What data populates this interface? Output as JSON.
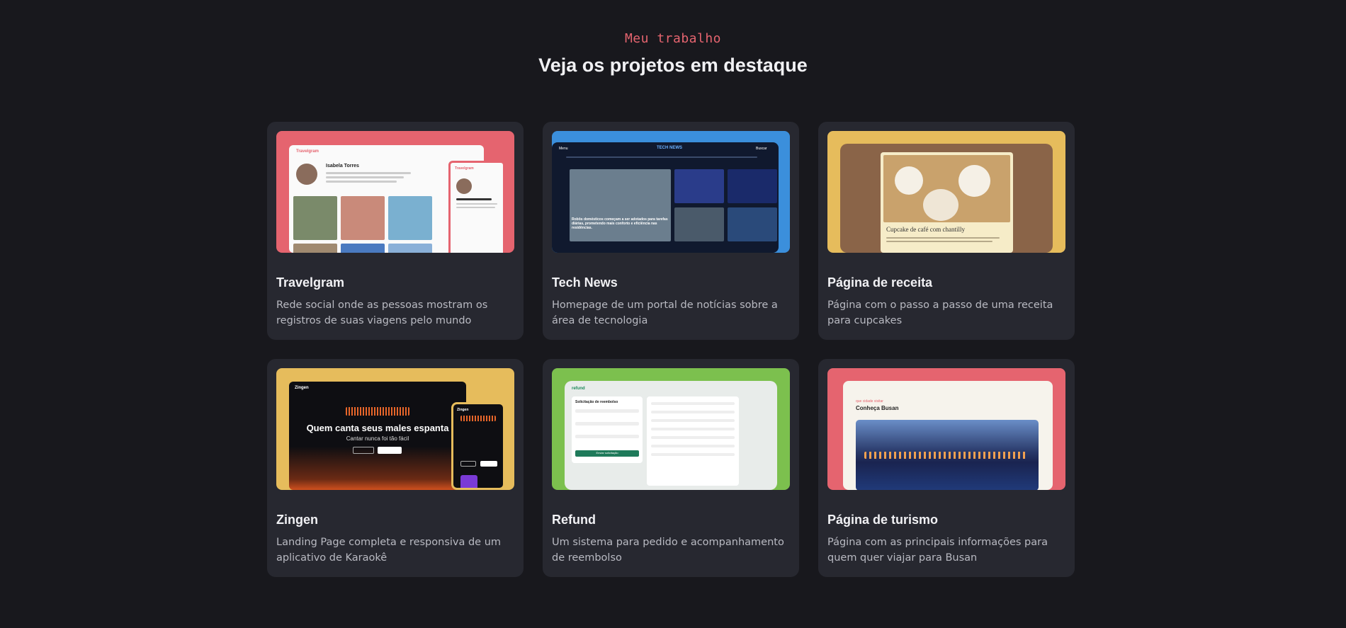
{
  "section": {
    "eyebrow": "Meu trabalho",
    "title": "Veja os projetos em destaque"
  },
  "projects": [
    {
      "title": "Travelgram",
      "description": "Rede social onde as pessoas mostram os registros de suas viagens pelo mundo",
      "accent": "#e5646f",
      "thumb": {
        "app": "Travelgram",
        "name": "Isabela Torres"
      }
    },
    {
      "title": "Tech News",
      "description": "Homepage de um portal de notícias sobre a área de tecnologia",
      "accent": "#3b8fdc",
      "thumb": {
        "app": "TECH NEWS",
        "menu": "Menu",
        "search": "Buscar",
        "headline": "Robôs domésticos começam a ser adotados para tarefas diárias, prometendo mais conforto e eficiência nas residências."
      }
    },
    {
      "title": "Página de receita",
      "description": "Página com o passo a passo de uma receita para cupcakes",
      "accent": "#e6bc5c",
      "thumb": {
        "heading": "Cupcake de café com chantilly"
      }
    },
    {
      "title": "Zingen",
      "description": "Landing Page completa e responsiva de um aplicativo de Karaokê",
      "accent": "#e6bc5c",
      "thumb": {
        "app": "Zingen",
        "headline": "Quem canta seus males espanta",
        "sub": "Cantar nunca foi tão fácil",
        "btn1": "Ver planos",
        "btn2": "Baixar agora"
      }
    },
    {
      "title": "Refund",
      "description": "Um sistema para pedido e acompanhamento de reembolso",
      "accent": "#7cc04e",
      "thumb": {
        "app": "refund",
        "form_title": "Solicitação de reembolso",
        "button": "Enviar solicitação"
      }
    },
    {
      "title": "Página de turismo",
      "description": "Página com as principais informações para quem quer viajar para Busan",
      "accent": "#e5646f",
      "thumb": {
        "kicker": "que cidade visitar",
        "heading": "Conheça Busan"
      }
    }
  ]
}
